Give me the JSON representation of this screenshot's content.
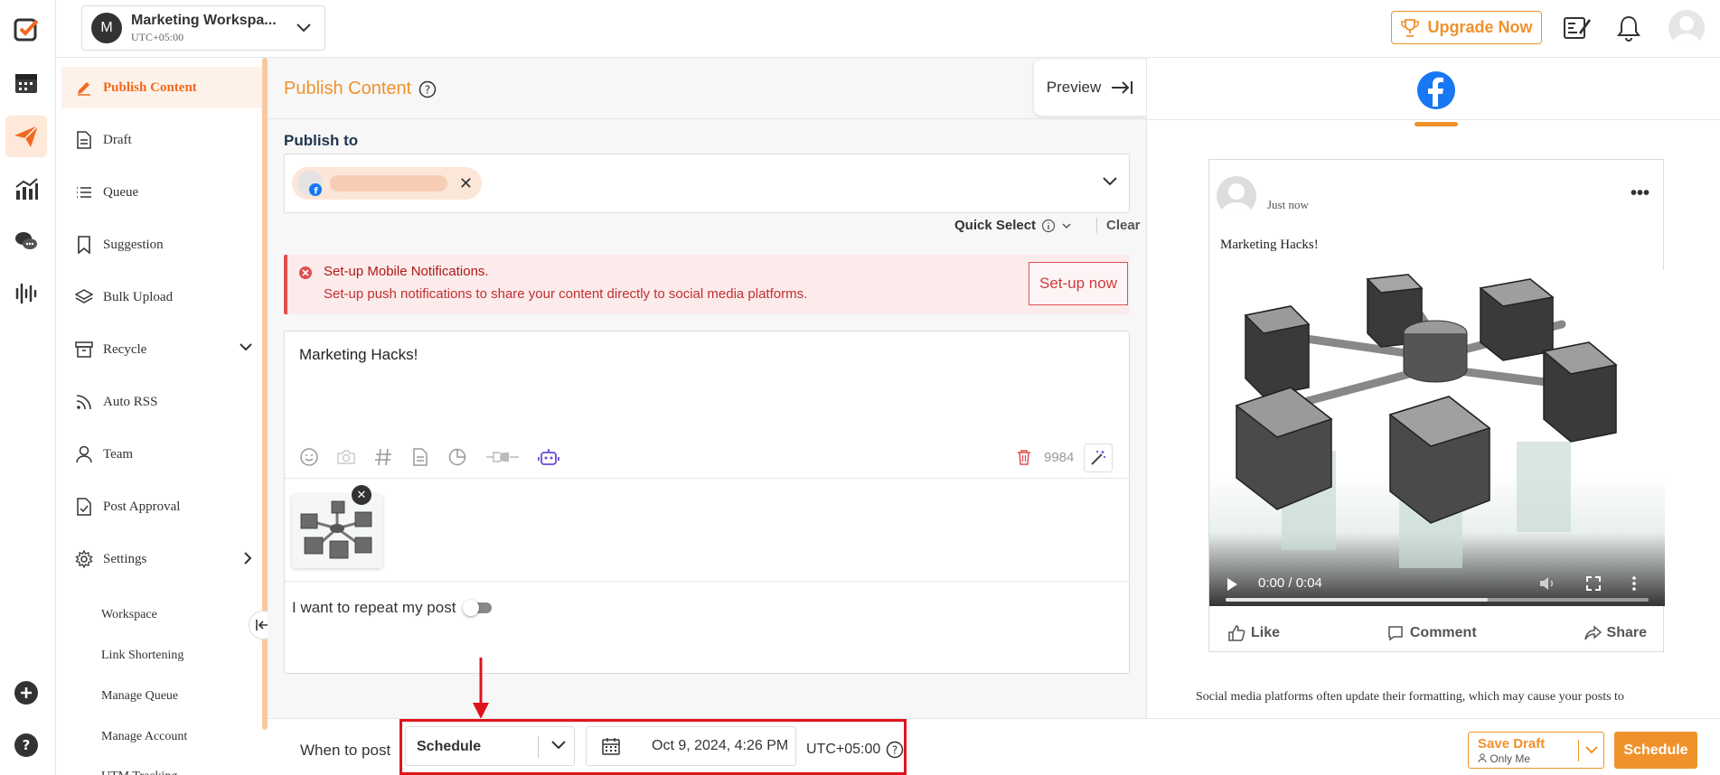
{
  "workspace": {
    "initial": "M",
    "name": "Marketing Workspa...",
    "timezone": "UTC+05:00"
  },
  "topbar": {
    "upgrade_label": "Upgrade Now"
  },
  "sidebar": {
    "items": [
      {
        "label": "Publish Content"
      },
      {
        "label": "Draft"
      },
      {
        "label": "Queue"
      },
      {
        "label": "Suggestion"
      },
      {
        "label": "Bulk Upload"
      },
      {
        "label": "Recycle"
      },
      {
        "label": "Auto RSS"
      },
      {
        "label": "Team"
      },
      {
        "label": "Post Approval"
      },
      {
        "label": "Settings"
      }
    ],
    "sub_items": [
      {
        "label": "Workspace"
      },
      {
        "label": "Link Shortening"
      },
      {
        "label": "Manage Queue"
      },
      {
        "label": "Manage Account"
      },
      {
        "label": "UTM Tracking"
      }
    ]
  },
  "main": {
    "title": "Publish Content",
    "preview_label": "Preview",
    "publish_to_label": "Publish to",
    "quick_select_label": "Quick Select",
    "clear_label": "Clear",
    "alert": {
      "title": "Set-up Mobile Notifications.",
      "description": "Set-up push notifications to share your content directly to social media platforms.",
      "button": "Set-up now"
    },
    "editor": {
      "text": "Marketing Hacks!",
      "char_count": "9984",
      "repeat_label": "I want to repeat my post"
    }
  },
  "bottom": {
    "when_label": "When to post",
    "schedule_option": "Schedule",
    "date_value": "Oct 9, 2024, 4:26 PM",
    "timezone": "UTC+05:00",
    "save_draft_label": "Save Draft",
    "save_draft_sub": "Only Me",
    "schedule_button": "Schedule"
  },
  "preview": {
    "time": "Just now",
    "text": "Marketing Hacks!",
    "video_time": "0:00 / 0:04",
    "video_progress": 0.62,
    "like": "Like",
    "comment": "Comment",
    "share": "Share",
    "disclaimer": "Social media platforms often update their formatting, which may cause your posts to"
  },
  "colors": {
    "accent": "#f0922b",
    "accent_dark": "#f06a1f",
    "highlight": "#e0141e",
    "facebook": "#1877f2"
  }
}
